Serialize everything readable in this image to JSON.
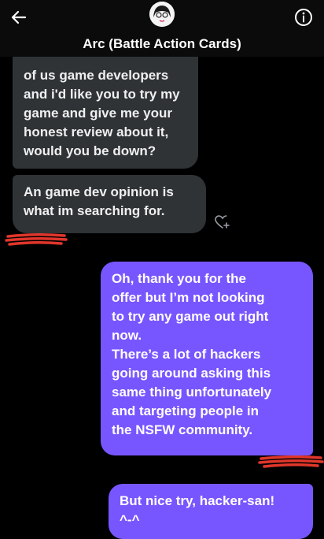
{
  "header": {
    "title": "Arc (Battle Action Cards)",
    "back_icon": "arrow-left-icon",
    "info_icon": "info-circle-icon"
  },
  "messages": [
    {
      "direction": "incoming",
      "lines": [
        "of us game developers",
        "and i'd like you to try my",
        "game and give me your",
        "honest review about it,",
        "would you be down?"
      ]
    },
    {
      "direction": "incoming",
      "lines": [
        "An game dev opinion is",
        "what im searching for."
      ]
    },
    {
      "direction": "outgoing",
      "lines": [
        "Oh, thank you for the",
        "offer but I’m not looking",
        "to try any game out right",
        "now.",
        "There’s a lot of hackers",
        "going around asking this",
        "same thing unfortunately",
        "and targeting people in",
        "the NSFW community."
      ]
    },
    {
      "direction": "outgoing",
      "lines": [
        "But nice try, hacker-san!",
        "^-^"
      ]
    }
  ],
  "colors": {
    "incoming_bubble": "#2f3336",
    "outgoing_bubble": "#7856ff",
    "background": "#000000",
    "redaction": "#e0362b"
  }
}
